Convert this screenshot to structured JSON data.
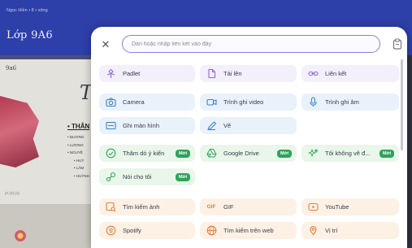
{
  "background": {
    "breadcrumb": "Ngọc Hiền • 8 • sống",
    "board_title": "Lớp 9A6",
    "card_label": "9a6",
    "big_letter": "T",
    "heading": "• THÂN",
    "lines": [
      "• DƯƠNG",
      "• LƯƠNG",
      "• NGUYỄ",
      "• HUỲ",
      "• LÂM",
      "• HUỲNH"
    ],
    "footer": "(A (3) (1)"
  },
  "modal": {
    "close_icon": "✕",
    "link_input_placeholder": "Dán hoặc nhập liên kết vào đây",
    "new_badge": "Mới",
    "items": {
      "padlet": "Padlet",
      "upload": "Tải lên",
      "link": "Liên kết",
      "camera": "Camera",
      "video_recorder": "Trình ghi video",
      "audio_recorder": "Trình ghi âm",
      "screen_recorder": "Ghi màn hình",
      "draw": "Vẽ",
      "poll": "Thăm dò ý kiến",
      "google_drive": "Google Drive",
      "ai_draw": "Tôi không vẽ đ...",
      "talk": "Nói cho tôi",
      "image_search": "Tìm kiếm ảnh",
      "gif": "GIF",
      "gif_icon_text": "GIF",
      "youtube": "YouTube",
      "spotify": "Spotify",
      "web_search": "Tìm kiếm trên web",
      "location": "Vị trí"
    }
  },
  "colors": {
    "header_blue": "#2d3fa8",
    "input_border": "#8b7fd9",
    "purple_tile": "#f3effc",
    "blue_tile": "#e9f1fb",
    "green_tile": "#e9f6ea",
    "orange_tile": "#fdf1e6",
    "badge_green": "#2fa35c"
  }
}
